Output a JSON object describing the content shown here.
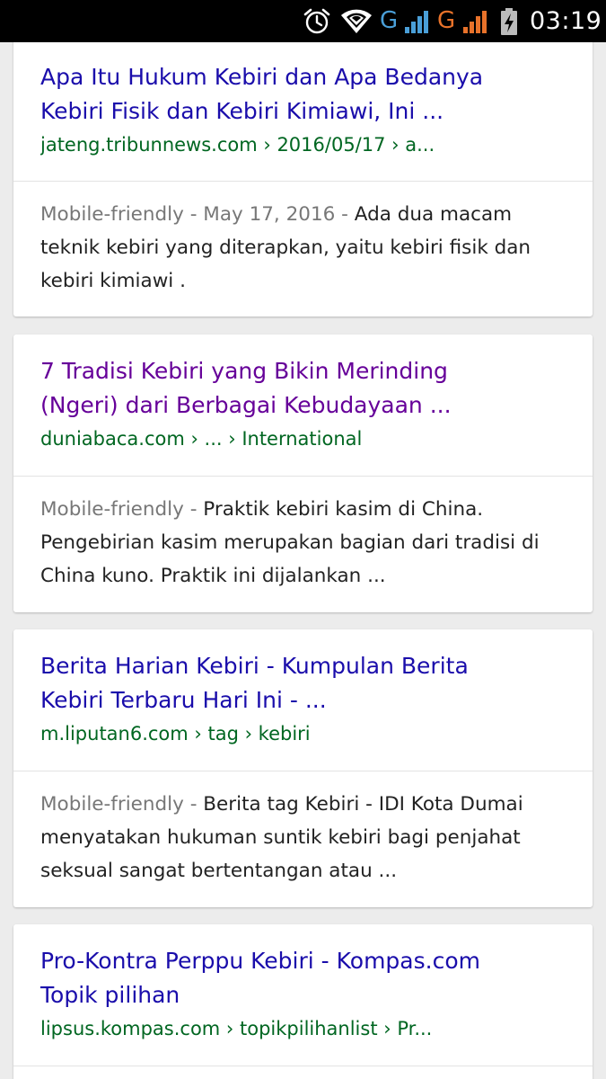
{
  "status_bar": {
    "time": "03:19",
    "network_1": "G",
    "network_2": "G",
    "icons": [
      "alarm-icon",
      "wifi-icon",
      "signal-icon",
      "signal-icon",
      "battery-charging-icon"
    ],
    "colors": {
      "network_1": "#4a9fd8",
      "network_2": "#e8722a"
    }
  },
  "results": [
    {
      "title_line1": "Apa Itu Hukum Kebiri dan Apa Bedanya",
      "title_line2": "Kebiri Fisik dan Kebiri Kimiawi, Ini ...",
      "url": "jateng.tribunnews.com › 2016/05/17 › a...",
      "meta": "Mobile-friendly - May 17, 2016 - ",
      "snippet": "Ada dua macam teknik kebiri yang diterapkan, yaitu kebiri fisik dan kebiri kimiawi ."
    },
    {
      "title_line1": "7 Tradisi Kebiri yang Bikin Merinding",
      "title_line2": "(Ngeri) dari Berbagai Kebudayaan ...",
      "url": "duniabaca.com › ... › International",
      "meta": "Mobile-friendly - ",
      "snippet": "Praktik kebiri kasim di China. Pengebirian kasim merupakan bagian dari tradisi di China kuno. Praktik ini dijalankan ..."
    },
    {
      "title_line1": "Berita Harian Kebiri - Kumpulan Berita",
      "title_line2": "Kebiri Terbaru Hari Ini - ...",
      "url": "m.liputan6.com › tag › kebiri",
      "meta": "Mobile-friendly - ",
      "snippet": "Berita tag Kebiri - IDI Kota Dumai menyatakan hukuman suntik kebiri bagi penjahat seksual sangat bertentangan atau ..."
    },
    {
      "title_line1": "Pro-Kontra Perppu Kebiri - Kompas.com",
      "title_line2": "Topik pilihan",
      "url": "lipsus.kompas.com › topikpilihanlist › Pr..."
    }
  ],
  "colors": {
    "link": "#1a0dab",
    "visited_link": "#660099",
    "url": "#006621",
    "meta": "#777777",
    "page_background": "#ececec"
  }
}
